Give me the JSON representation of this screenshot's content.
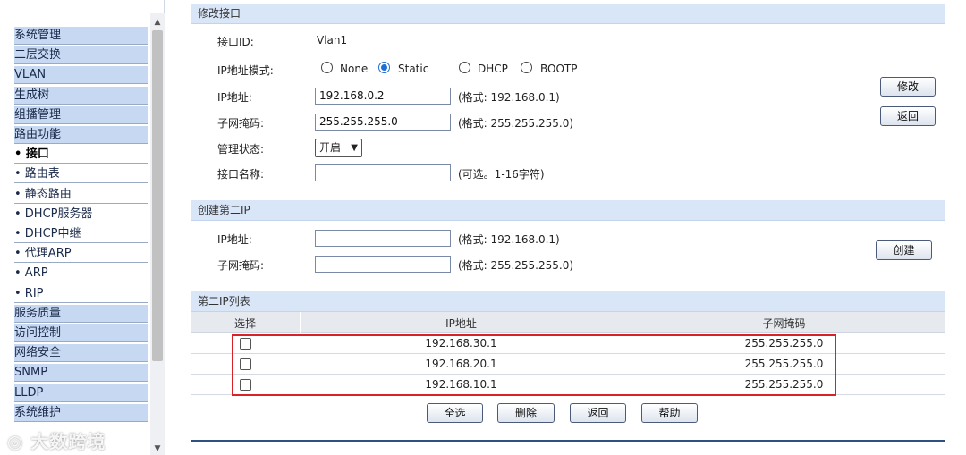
{
  "sidebar": {
    "items": [
      {
        "label": "系统管理",
        "type": "plain"
      },
      {
        "label": "二层交换",
        "type": "plain"
      },
      {
        "label": "VLAN",
        "type": "plain"
      },
      {
        "label": "生成树",
        "type": "plain"
      },
      {
        "label": "组播管理",
        "type": "plain"
      },
      {
        "label": "路由功能",
        "type": "plain"
      },
      {
        "label": "• 接口",
        "type": "active"
      },
      {
        "label": "• 路由表",
        "type": "sub"
      },
      {
        "label": "• 静态路由",
        "type": "sub"
      },
      {
        "label": "• DHCP服务器",
        "type": "sub"
      },
      {
        "label": "• DHCP中继",
        "type": "sub"
      },
      {
        "label": "• 代理ARP",
        "type": "sub"
      },
      {
        "label": "• ARP",
        "type": "sub"
      },
      {
        "label": "• RIP",
        "type": "sub"
      },
      {
        "label": "服务质量",
        "type": "plain"
      },
      {
        "label": "访问控制",
        "type": "plain"
      },
      {
        "label": "网络安全",
        "type": "plain"
      },
      {
        "label": "SNMP",
        "type": "plain"
      },
      {
        "label": "LLDP",
        "type": "plain"
      },
      {
        "label": "系统维护",
        "type": "plain"
      }
    ],
    "watermark": "大数跨境"
  },
  "modify": {
    "title": "修改接口",
    "interface_id_label": "接口ID:",
    "interface_id_value": "Vlan1",
    "ip_mode_label": "IP地址模式:",
    "mode_options": [
      "None",
      "Static",
      "DHCP",
      "BOOTP"
    ],
    "mode_selected": "Static",
    "ip_label": "IP地址:",
    "ip_value": "192.168.0.2",
    "ip_hint": "(格式: 192.168.0.1)",
    "mask_label": "子网掩码:",
    "mask_value": "255.255.255.0",
    "mask_hint": "(格式: 255.255.255.0)",
    "admin_label": "管理状态:",
    "admin_value": "开启",
    "name_label": "接口名称:",
    "name_value": "",
    "name_hint": "(可选。1-16字符)",
    "modify_button": "修改",
    "back_button": "返回"
  },
  "create": {
    "title": "创建第二IP",
    "ip_label": "IP地址:",
    "ip_hint": "(格式: 192.168.0.1)",
    "mask_label": "子网掩码:",
    "mask_hint": "(格式: 255.255.255.0)",
    "create_button": "创建"
  },
  "list": {
    "title": "第二IP列表",
    "columns": [
      "选择",
      "IP地址",
      "子网掩码"
    ],
    "rows": [
      {
        "ip": "192.168.30.1",
        "mask": "255.255.255.0"
      },
      {
        "ip": "192.168.20.1",
        "mask": "255.255.255.0"
      },
      {
        "ip": "192.168.10.1",
        "mask": "255.255.255.0"
      }
    ],
    "buttons": [
      "全选",
      "删除",
      "返回",
      "帮助"
    ]
  },
  "colors": {
    "highlight": "#d9212a",
    "section_bar": "#d9e6f7",
    "radio_checked": "#1f6fd6"
  }
}
